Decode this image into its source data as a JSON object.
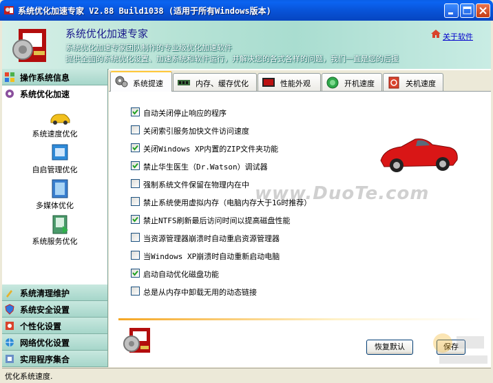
{
  "window": {
    "title": "系统优化加速专家 V2.88 Build1038 (适用于所有Windows版本)"
  },
  "banner": {
    "app_name": "系统优化加速专家",
    "desc_line1": "系统优化加速专家团队制作的专业级优化加速软件",
    "desc_line2": "提供全面的系统优化设置、加速系统和软件运行，并解决您的各式各样的问题，我们一直是您的后援",
    "about_link": "关于软件"
  },
  "sidebar": {
    "sections": [
      {
        "label": "操作系统信息",
        "icon": "windows-flag-icon"
      },
      {
        "label": "系统优化加速",
        "icon": "gear-icon"
      },
      {
        "label": "系统清理维护",
        "icon": "broom-icon"
      },
      {
        "label": "系统安全设置",
        "icon": "shield-icon"
      },
      {
        "label": "个性化设置",
        "icon": "personalize-icon"
      },
      {
        "label": "网络优化设置",
        "icon": "network-icon"
      },
      {
        "label": "实用程序集合",
        "icon": "tools-icon"
      }
    ],
    "items": [
      {
        "label": "系统速度优化",
        "icon": "car-icon"
      },
      {
        "label": "自启管理优化",
        "icon": "window-icon"
      },
      {
        "label": "多媒体优化",
        "icon": "film-icon"
      },
      {
        "label": "系统服务优化",
        "icon": "service-icon"
      }
    ]
  },
  "tabs": [
    {
      "label": "系统提速",
      "icon": "gear-icon",
      "active": true
    },
    {
      "label": "内存、缓存优化",
      "icon": "memory-chip-icon",
      "active": false
    },
    {
      "label": "性能外观",
      "icon": "monitor-icon",
      "active": false
    },
    {
      "label": "开机速度",
      "icon": "power-icon",
      "active": false
    },
    {
      "label": "关机速度",
      "icon": "shutdown-icon",
      "active": false
    }
  ],
  "options": [
    {
      "label": "自动关闭停止响应的程序",
      "checked": true
    },
    {
      "label": "关闭索引服务加快文件访问速度",
      "checked": false
    },
    {
      "label": "关闭Windows XP内置的ZIP文件夹功能",
      "checked": true
    },
    {
      "label": "禁止华生医生（Dr.Watson）调试器",
      "checked": true
    },
    {
      "label": "强制系统文件保留在物理内在中",
      "checked": false
    },
    {
      "label": "禁止系统使用虚拟内存（电脑内存大于1G时推荐）",
      "checked": false
    },
    {
      "label": "禁止NTFS刷新最后访问时间以提高磁盘性能",
      "checked": true
    },
    {
      "label": "当资源管理器崩溃时自动重启资源管理器",
      "checked": false
    },
    {
      "label": "当Windows XP崩溃时自动重新启动电脑",
      "checked": false
    },
    {
      "label": "启动自动优化磁盘功能",
      "checked": true
    },
    {
      "label": "总是从内存中卸载无用的动态链接",
      "checked": false
    }
  ],
  "buttons": {
    "restore": "恢复默认",
    "save": "保存"
  },
  "watermark": "www.DuoTe.com",
  "status": {
    "text": "优化系统速度."
  }
}
